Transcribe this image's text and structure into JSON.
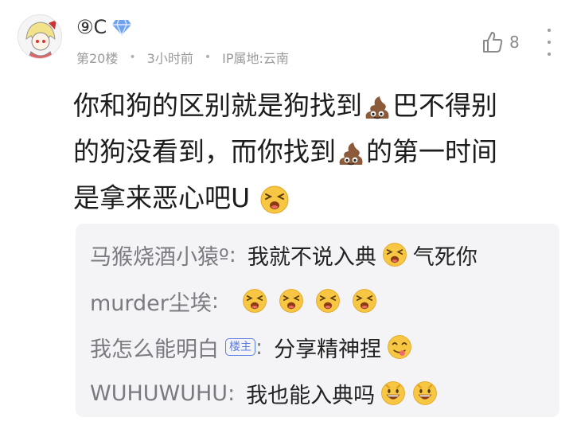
{
  "header": {
    "username": "⑨C",
    "floor": "第20楼",
    "time": "3小时前",
    "ip_location": "IP属地:云南",
    "like_count": "8"
  },
  "content": {
    "line1_a": "你和狗的区别就是狗找到",
    "line1_b": "巴不得别",
    "line2_a": "的狗没看到，而你找到",
    "line2_b": "的第一时间",
    "line3_a": "是拿来恶心吧U"
  },
  "replies": [
    {
      "name": "马猴烧酒小猿º",
      "text_a": "我就不说入典",
      "text_b": "气死你"
    },
    {
      "name": "murder尘埃",
      "text_a": ""
    },
    {
      "name": "我怎么能明白",
      "badge": "楼主",
      "text_a": "分享精神捏"
    },
    {
      "name": "WUHUWUHU",
      "text_a": "我也能入典吗"
    }
  ],
  "colors": {
    "badge": "#5c7ee0",
    "reply_bg": "#f4f4f7",
    "meta": "#9a9a9a"
  }
}
